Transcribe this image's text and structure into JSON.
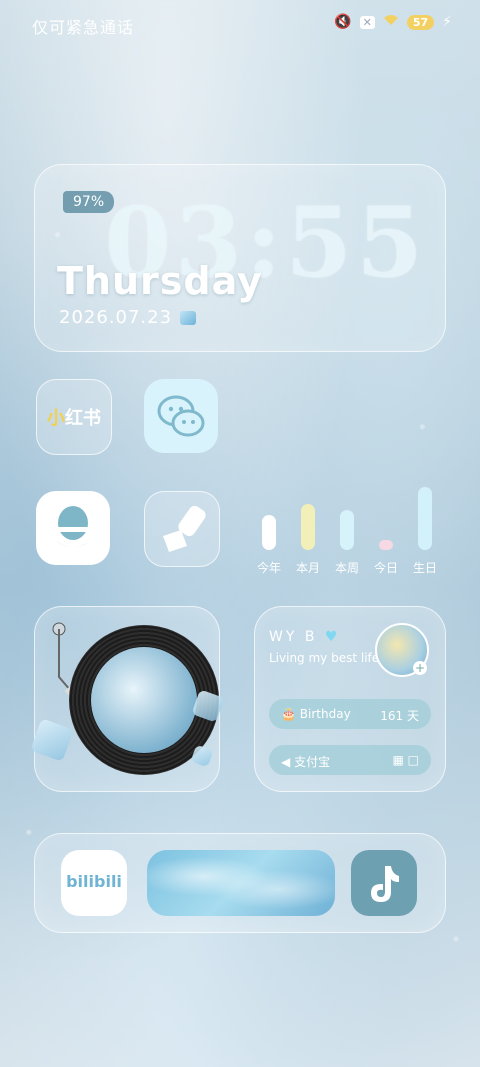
{
  "status_bar": {
    "carrier_text": "仅可紧急通话",
    "icons": [
      "mute-icon",
      "close-badge-icon",
      "wifi-icon",
      "battery-icon",
      "charging-icon"
    ],
    "battery_level": "57"
  },
  "clock_widget": {
    "battery_percent": "97%",
    "time": "03:55",
    "day": "Thursday",
    "date": "2026.07.23"
  },
  "apps": {
    "xiaohongshu": {
      "label": "小红书",
      "icon": "xiaohongshu-icon"
    },
    "wechat": {
      "icon": "wechat-icon"
    },
    "qq": {
      "icon": "qq-icon"
    },
    "cleaner": {
      "icon": "broom-icon"
    },
    "bilibili": {
      "label": "bilibili",
      "icon": "bilibili-icon"
    },
    "tiktok": {
      "icon": "tiktok-icon"
    }
  },
  "progress_bars": {
    "items": [
      {
        "label": "今年",
        "fraction": 0.55,
        "color": "#ffffff"
      },
      {
        "label": "本月",
        "fraction": 0.72,
        "color": "#f2efb8"
      },
      {
        "label": "本周",
        "fraction": 0.62,
        "color": "#d6f2fa"
      },
      {
        "label": "今日",
        "fraction": 0.15,
        "color": "#f6d9e2"
      },
      {
        "label": "生日",
        "fraction": 0.98,
        "color": "#d3f1fb"
      }
    ]
  },
  "profile_widget": {
    "name": "WY B",
    "motto": "Living my best life",
    "birthday_label": "Birthday",
    "birthday_days": "161 天",
    "alipay_label": "支付宝"
  },
  "colors": {
    "accent": "#7fc6e0",
    "battery_yellow": "#f3d062"
  }
}
